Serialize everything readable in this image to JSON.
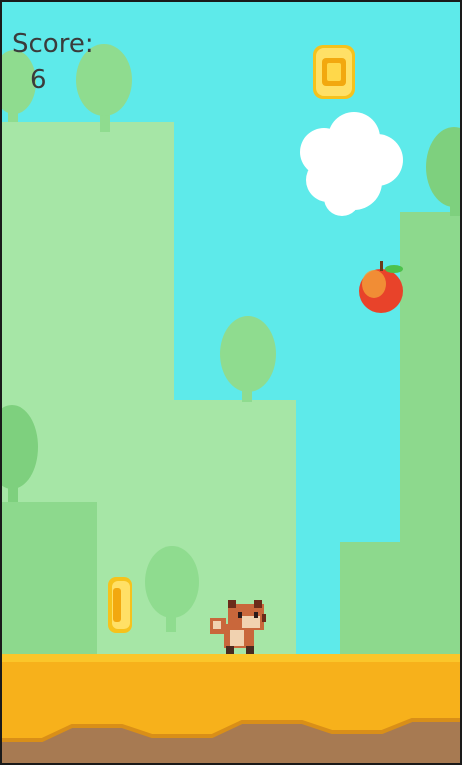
{
  "hud": {
    "score_label": "Score:",
    "score_value": "6"
  },
  "scene": {
    "sky_color": "#5eeaea",
    "ground_color": "#f7b11b",
    "dirt_color": "#a77a52",
    "hill_light": "#a6e6a6",
    "hill_mid": "#8dd98d",
    "items": [
      "coin-icon",
      "coin-icon",
      "apple-icon",
      "cloud",
      "fox-character"
    ]
  }
}
